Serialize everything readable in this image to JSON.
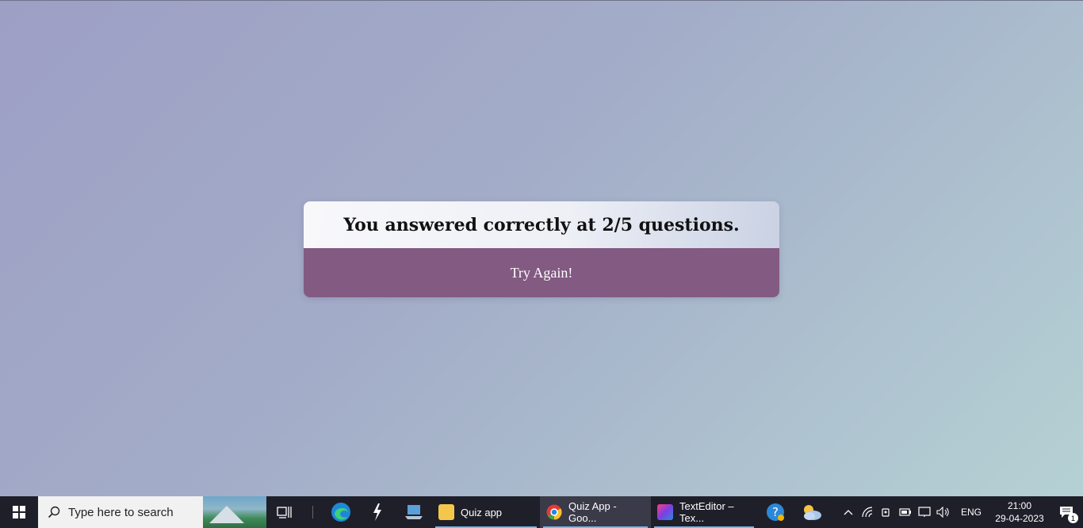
{
  "quiz": {
    "result_text": "You answered correctly at 2/5 questions.",
    "try_again_label": "Try Again!"
  },
  "taskbar": {
    "search_placeholder": "Type here to search",
    "apps": [
      {
        "name": "file-explorer",
        "label": "Quiz app"
      },
      {
        "name": "chrome",
        "label": "Quiz App - Goo..."
      },
      {
        "name": "intellij",
        "label": "TextEditor – Tex..."
      }
    ],
    "tray": {
      "language": "ENG",
      "time": "21:00",
      "date": "29-04-2023",
      "notification_count": "1"
    }
  },
  "colors": {
    "button_bg": "#825a82",
    "taskbar_bg": "#1f1f2a"
  }
}
